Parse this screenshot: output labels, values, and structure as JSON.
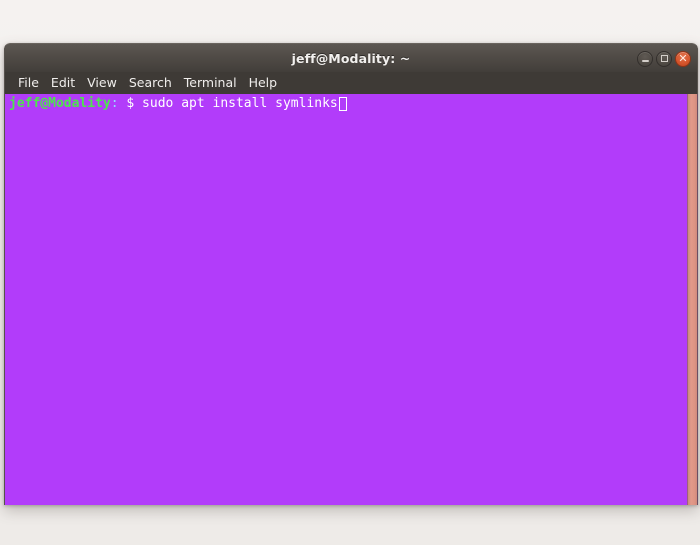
{
  "desktop": {
    "background_color": "#f2efec"
  },
  "window": {
    "title": "jeff@Modality: ~",
    "controls": {
      "minimize_label": "–",
      "maximize_label": "□",
      "close_label": "✕"
    },
    "menu": [
      {
        "label": "File"
      },
      {
        "label": "Edit"
      },
      {
        "label": "View"
      },
      {
        "label": "Search"
      },
      {
        "label": "Terminal"
      },
      {
        "label": "Help"
      }
    ]
  },
  "terminal": {
    "background_color": "#b23cfa",
    "scrollbar_color": "#e29a8a",
    "prompt": {
      "user_host": "jeff@Modality",
      "separator": ":",
      "path": " ",
      "sigil": "$",
      "command": " sudo apt install symlinks"
    },
    "cursor": {
      "style": "hollow-block",
      "color": "#ffffff"
    }
  }
}
